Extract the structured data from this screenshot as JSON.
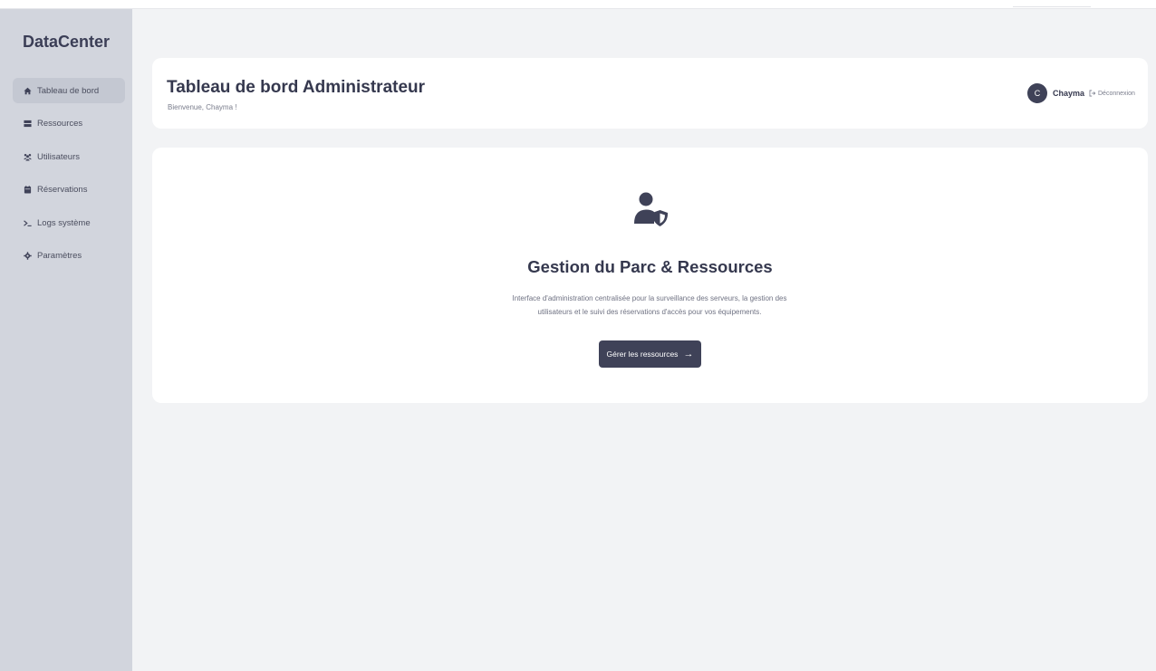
{
  "brand": "DataCenter",
  "sidebar": {
    "items": [
      {
        "label": "Tableau de bord",
        "icon": "home-icon",
        "active": true
      },
      {
        "label": "Ressources",
        "icon": "server-icon",
        "active": false
      },
      {
        "label": "Utilisateurs",
        "icon": "users-icon",
        "active": false
      },
      {
        "label": "Réservations",
        "icon": "calendar-icon",
        "active": false
      },
      {
        "label": "Logs système",
        "icon": "terminal-icon",
        "active": false
      },
      {
        "label": "Paramètres",
        "icon": "gear-icon",
        "active": false
      }
    ]
  },
  "header": {
    "title": "Tableau de bord Administrateur",
    "welcome": "Bienvenue, Chayma !",
    "avatar_initial": "C",
    "username": "Chayma",
    "logout_label": "Déconnexion"
  },
  "hero": {
    "icon": "user-shield-icon",
    "title": "Gestion du Parc & Ressources",
    "description_line1": "Interface d'administration centralisée pour la surveillance des serveurs, la gestion des",
    "description_line2": "utilisateurs et le suivi des réservations d'accès pour vos équipements.",
    "cta_label": "Gérer les ressources",
    "cta_arrow": "→"
  },
  "colors": {
    "sidebar_bg": "#d2d5dd",
    "active_item_bg": "#c4c8d2",
    "page_bg": "#f2f3f5",
    "accent": "#3f4258"
  }
}
